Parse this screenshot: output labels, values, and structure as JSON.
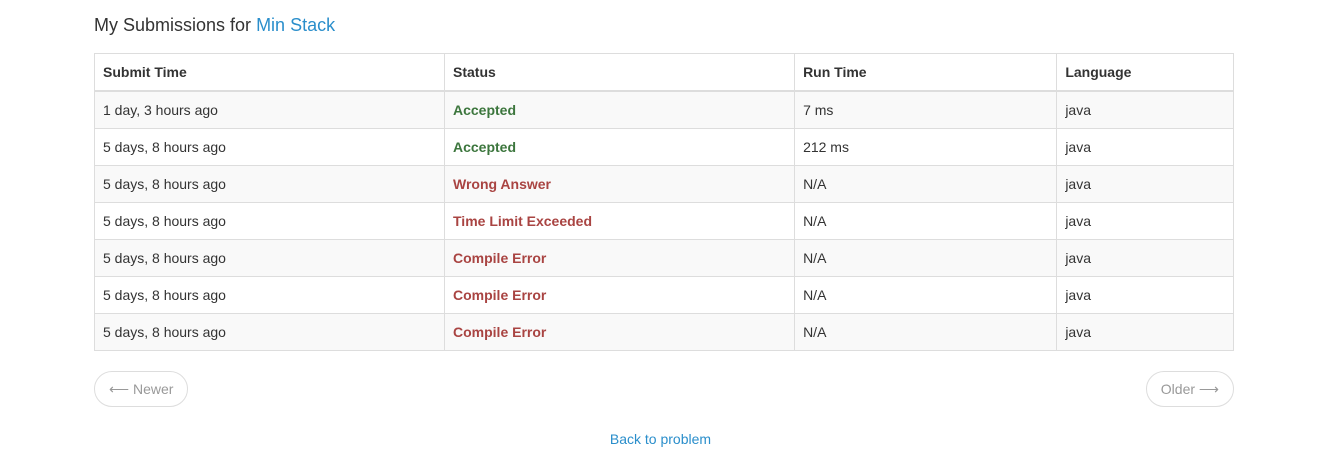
{
  "header": {
    "prefix": "My Submissions for",
    "problem_title": "Min Stack"
  },
  "table": {
    "columns": [
      "Submit Time",
      "Status",
      "Run Time",
      "Language"
    ],
    "rows": [
      {
        "time": "1 day, 3 hours ago",
        "status": "Accepted",
        "run_time": "7 ms",
        "language": "java"
      },
      {
        "time": "5 days, 8 hours ago",
        "status": "Accepted",
        "run_time": "212 ms",
        "language": "java"
      },
      {
        "time": "5 days, 8 hours ago",
        "status": "Wrong Answer",
        "run_time": "N/A",
        "language": "java"
      },
      {
        "time": "5 days, 8 hours ago",
        "status": "Time Limit Exceeded",
        "run_time": "N/A",
        "language": "java"
      },
      {
        "time": "5 days, 8 hours ago",
        "status": "Compile Error",
        "run_time": "N/A",
        "language": "java"
      },
      {
        "time": "5 days, 8 hours ago",
        "status": "Compile Error",
        "run_time": "N/A",
        "language": "java"
      },
      {
        "time": "5 days, 8 hours ago",
        "status": "Compile Error",
        "run_time": "N/A",
        "language": "java"
      }
    ]
  },
  "pager": {
    "newer_label": "Newer",
    "newer_arrow": "⟵",
    "older_label": "Older",
    "older_arrow": "⟶"
  },
  "footer": {
    "back_label": "Back to problem"
  },
  "colors": {
    "link": "#2a8ecb",
    "accepted": "#3c763d",
    "error": "#a94442"
  }
}
